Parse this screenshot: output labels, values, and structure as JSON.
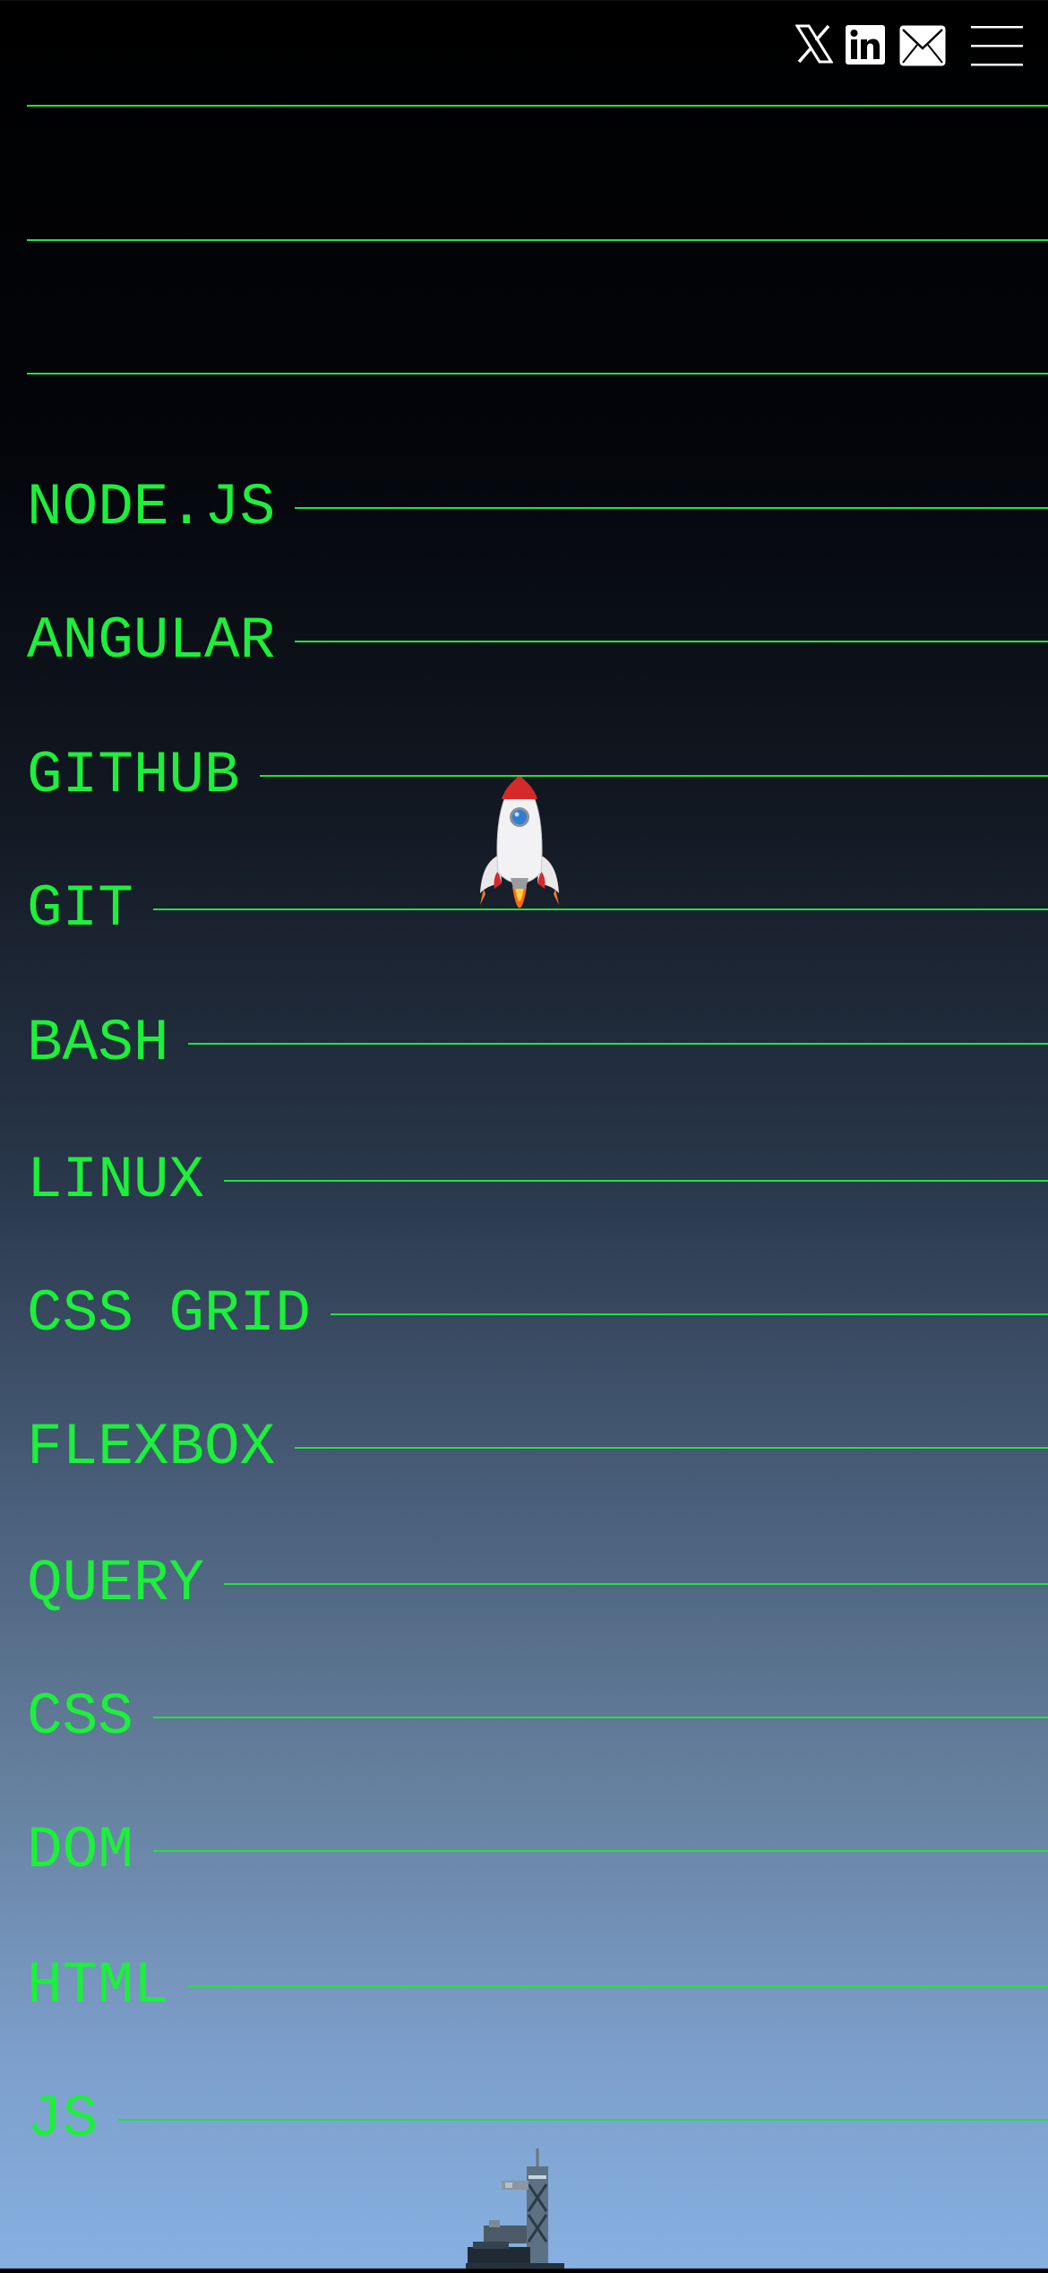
{
  "header": {
    "icons": [
      "x-icon",
      "linkedin-icon",
      "mail-icon",
      "menu-icon"
    ]
  },
  "skills": [
    {
      "label": ""
    },
    {
      "label": ""
    },
    {
      "label": ""
    },
    {
      "label": "NODE.JS"
    },
    {
      "label": "ANGULAR"
    },
    {
      "label": "GITHUB"
    },
    {
      "label": "GIT"
    },
    {
      "label": "BASH"
    },
    {
      "label": "LINUX"
    },
    {
      "label": "CSS GRID"
    },
    {
      "label": "FLEXBOX"
    },
    {
      "label": "QUERY"
    },
    {
      "label": "CSS"
    },
    {
      "label": "DOM"
    },
    {
      "label": "HTML"
    },
    {
      "label": "JS"
    }
  ],
  "colors": {
    "accent": "#1cf03a",
    "line": "#22e23d",
    "icon": "#ffffff"
  }
}
